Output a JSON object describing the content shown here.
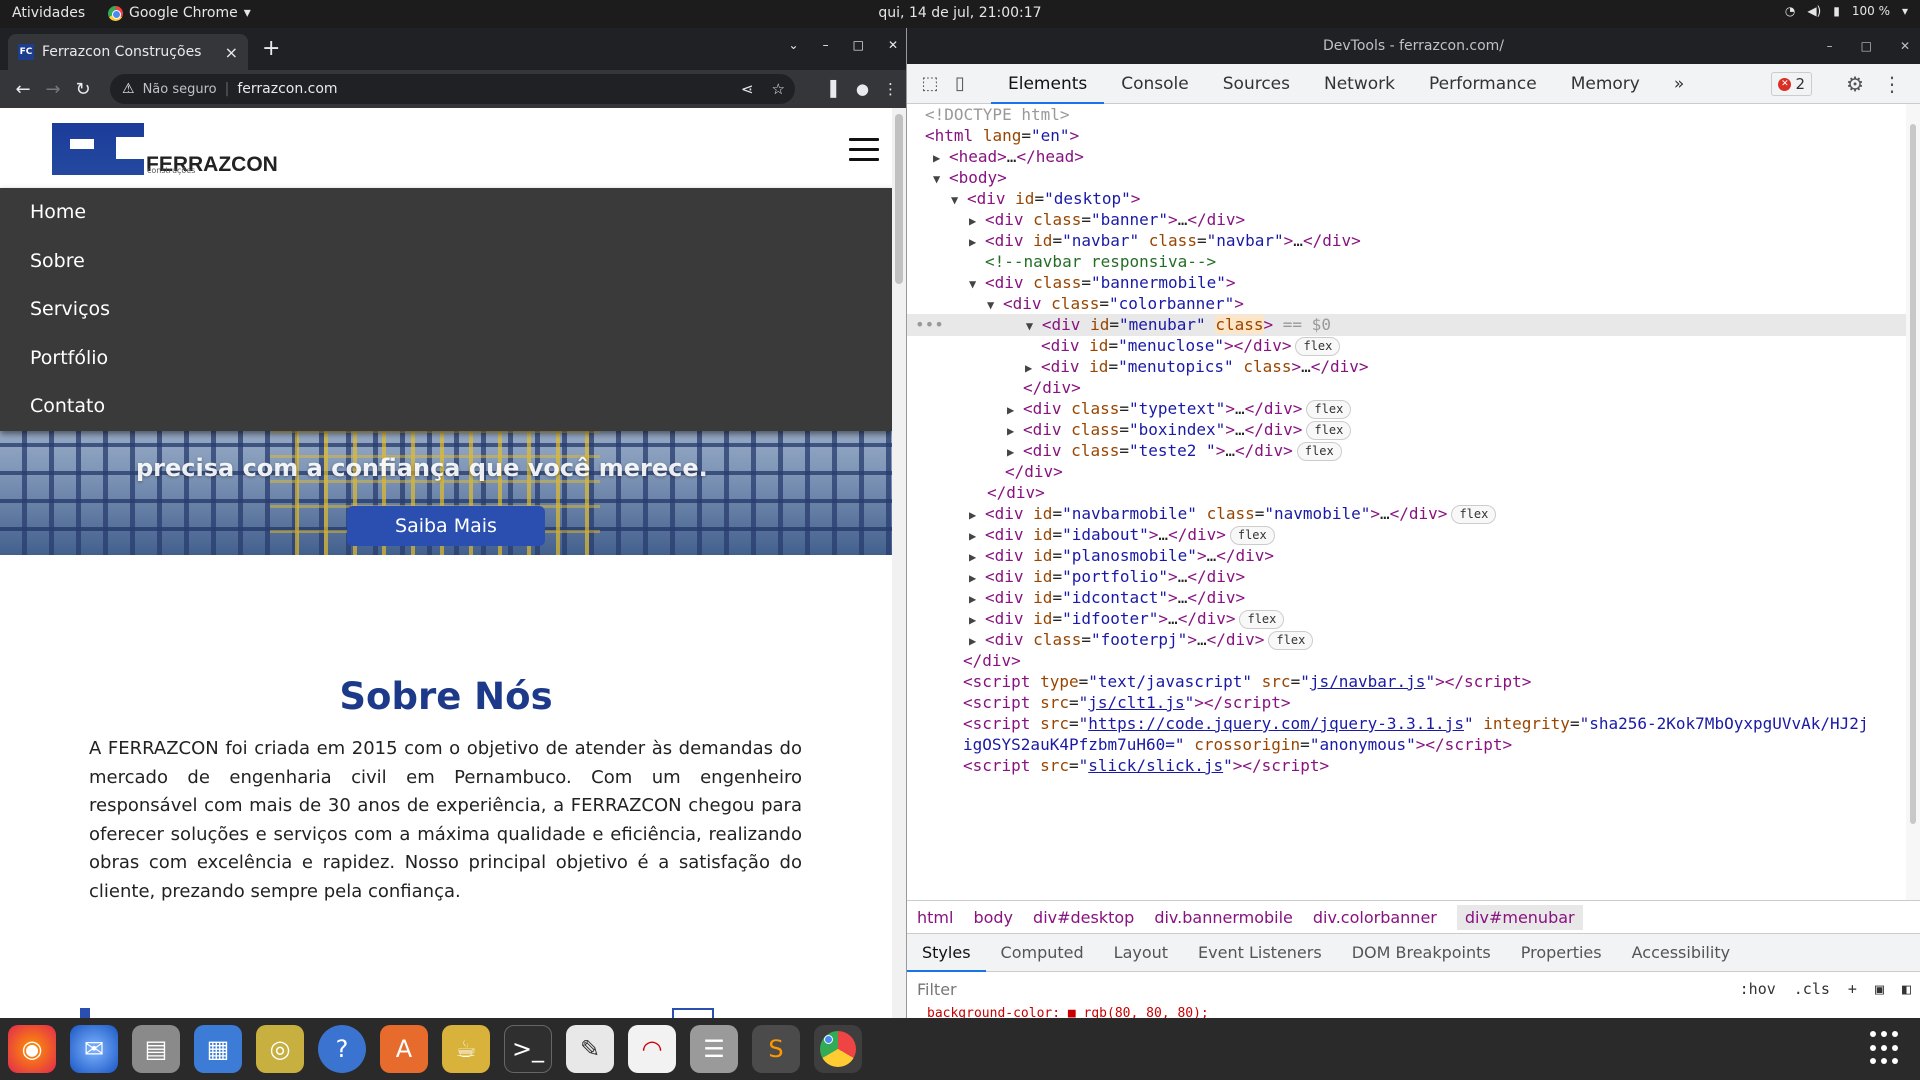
{
  "system": {
    "activities": "Atividades",
    "app_name": "Google Chrome",
    "clock": "qui, 14 de jul, 21:00:17",
    "battery": "100 %"
  },
  "browser": {
    "tab_title": "Ferrazcon Construções",
    "security": "Não seguro",
    "url": "ferrazcon.com"
  },
  "site": {
    "logo_text": "FERRAZCON",
    "logo_sub": "construções",
    "menu": [
      "Home",
      "Sobre",
      "Serviços",
      "Portfólio",
      "Contato"
    ],
    "hero_text": "precisa com a confiança que você merece.",
    "hero_button": "Saiba Mais",
    "about_title": "Sobre Nós",
    "about_text": "A FERRAZCON foi criada em 2015 com o objetivo de atender às demandas do mercado de engenharia civil em Pernambuco. Com um engenheiro responsável com mais de 30 anos de experiência, a FERRAZCON chegou para oferecer soluções e serviços com a máxima qualidade e eficiência, realizando obras com excelência e rapidez. Nosso principal objetivo é a satisfação do cliente, prezando sempre pela confiança."
  },
  "devtools": {
    "window_title": "DevTools - ferrazcon.com/",
    "tabs": [
      "Elements",
      "Console",
      "Sources",
      "Network",
      "Performance",
      "Memory"
    ],
    "error_count": "2",
    "breadcrumbs": [
      "html",
      "body",
      "div#desktop",
      "div.bannermobile",
      "div.colorbanner",
      "div#menubar"
    ],
    "subtabs": [
      "Styles",
      "Computed",
      "Layout",
      "Event Listeners",
      "DOM Breakpoints",
      "Properties",
      "Accessibility"
    ],
    "filter_placeholder": "Filter",
    "filter_tools": [
      ":hov",
      ".cls",
      "+"
    ],
    "cut_text": "background-color: ■ rgb(80, 80, 80);"
  },
  "dock": [
    "firefox-icon",
    "thunderbird-icon",
    "files-icon",
    "document-viewer-icon",
    "rhythmbox-icon",
    "help-icon",
    "software-icon",
    "wine-icon",
    "terminal-icon",
    "text-editor-icon",
    "pdf-icon",
    "database-icon",
    "sublime-icon",
    "chrome-icon"
  ]
}
